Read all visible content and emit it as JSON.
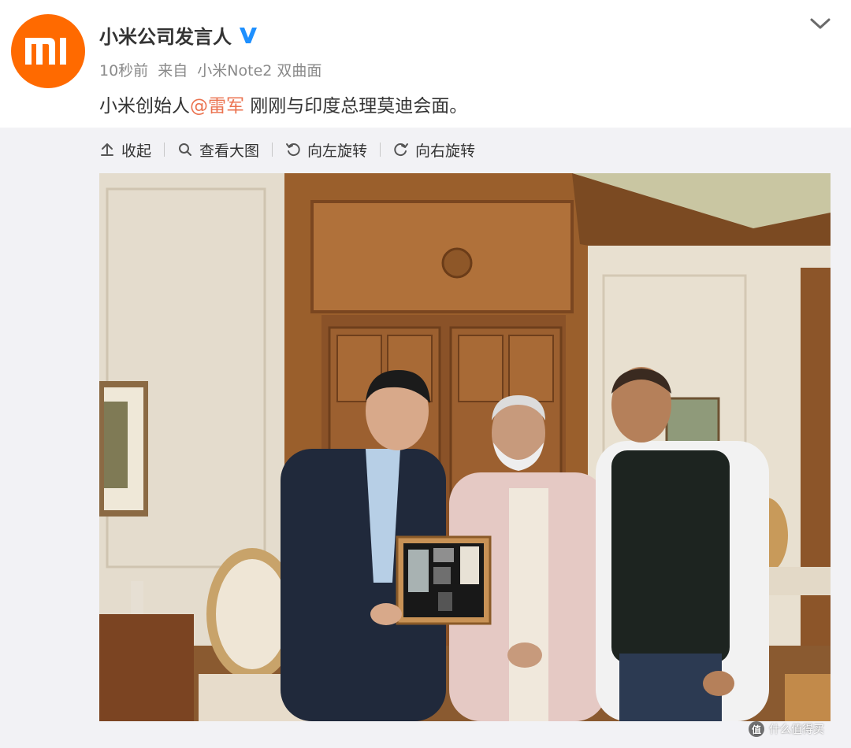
{
  "post": {
    "author": "小米公司发言人",
    "time": "10秒前",
    "source_prefix": "来自",
    "device": "小米Note2 双曲面",
    "text_before": "小米创始人",
    "mention": "@雷军",
    "text_after": " 刚刚与印度总理莫迪会面。"
  },
  "toolbar": {
    "collapse": "收起",
    "view_large": "查看大图",
    "rotate_left": "向左旋转",
    "rotate_right": "向右旋转"
  },
  "watermark": {
    "text": "什么值得买",
    "symbol": "值"
  },
  "colors": {
    "brand_orange": "#ff6a00",
    "mention": "#eb7350",
    "verified_blue": "#1e90ff",
    "meta_gray": "#8a8a8a"
  },
  "icons": {
    "collapse": "upload-arrow-icon",
    "view_large": "magnifier-icon",
    "rotate_left": "rotate-left-icon",
    "rotate_right": "rotate-right-icon"
  }
}
